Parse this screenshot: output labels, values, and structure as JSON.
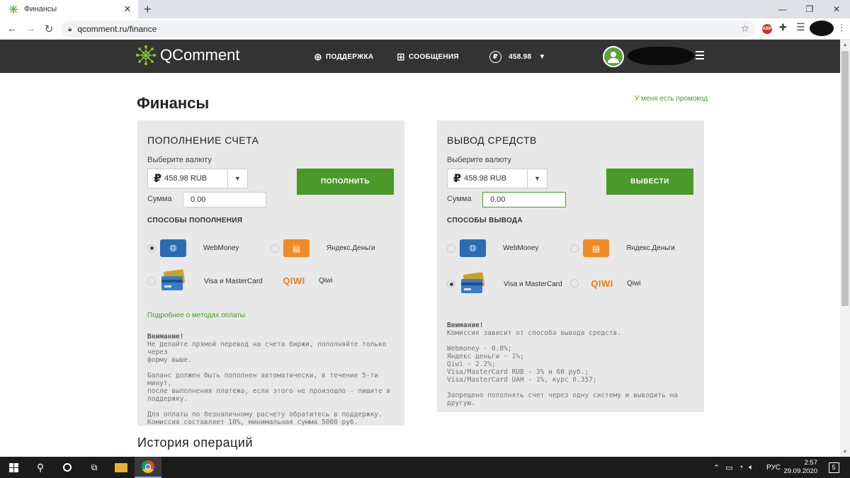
{
  "browser": {
    "tab_title": "Финансы",
    "tab_close": "✕",
    "new_tab": "+",
    "url": "qcomment.ru/finance",
    "window_controls": [
      "—",
      "❐",
      "✕"
    ]
  },
  "header": {
    "logo_text": "QComment",
    "support": "ПОДДЕРЖКА",
    "messages": "СООБЩЕНИЯ",
    "balance": "458.98",
    "currency_icon": "₽"
  },
  "page": {
    "title": "Финансы",
    "promo_link": "У меня есть промокод",
    "history_title": "История операций"
  },
  "deposit": {
    "heading": "ПОПОЛНЕНИЕ СЧЕТА",
    "currency_label": "Выберите валюту",
    "currency_value": "458.98 RUB",
    "sum_label": "Сумма",
    "sum_value": "0.00",
    "button": "ПОПОЛНИТЬ",
    "methods_heading": "СПОСОБЫ ПОПОЛНЕНИЯ",
    "methods": [
      {
        "name": "WebMoney",
        "selected": true
      },
      {
        "name": "Яндекс.Деньги",
        "selected": false
      },
      {
        "name": "Visa и MasterCard",
        "selected": false
      },
      {
        "name": "Qiwi",
        "selected": false
      }
    ],
    "more_link": "Подробнее о методах оплаты",
    "note_title": "Внимание!",
    "notes": [
      "Не делайте прямой перевод на счета биржи, пополняйте только через\nформу выше.",
      "Баланс должен быть пополнен автоматически, в течение 5-ти минут,\nпосле выполнения платежа, если этого не произошло - пишите в\nподдержку.",
      "Для оплаты по безналичному расчету обратитесь в поддержку.\nКомиссия составляет 10%, минимальная сумма 5000 руб."
    ]
  },
  "withdraw": {
    "heading": "ВЫВОД СРЕДСТВ",
    "currency_label": "Выберите валюту",
    "currency_value": "458.98 RUB",
    "sum_label": "Сумма",
    "sum_value": "0.00",
    "button": "ВЫВЕСТИ",
    "methods_heading": "СПОСОБЫ ВЫВОДА",
    "methods": [
      {
        "name": "WebMoney",
        "selected": false
      },
      {
        "name": "Яндекс.Деньги",
        "selected": false
      },
      {
        "name": "Visa и MasterCard",
        "selected": true
      },
      {
        "name": "Qiwi",
        "selected": false
      }
    ],
    "note_title": "Внимание!",
    "note_intro": "Комиссия зависит от способа вывода средств.",
    "fees": "Webmoney - 0.8%;\nЯндекс деньги - 1%;\nQiwi - 2.2%;\nVisa/MasterCard RUB - 3% и 60 руб.;\nVisa/MasterCard UAH - 1%, курс 0.357;",
    "warning": "Запрещено пополнять счет через одну систему и выводить на другую."
  },
  "icons": {
    "qiwi_logo": "QIWI"
  },
  "colors": {
    "accent_green": "#4a9a2a",
    "header_bg": "#333333",
    "panel_bg": "#e8e8e8",
    "webmoney_blue": "#2b6db5",
    "yandex_orange": "#f08a24",
    "qiwi_orange": "#f07a1a"
  },
  "taskbar": {
    "language": "РУС",
    "time": "2:57",
    "date": "29.09.2020",
    "notifications": "5"
  }
}
